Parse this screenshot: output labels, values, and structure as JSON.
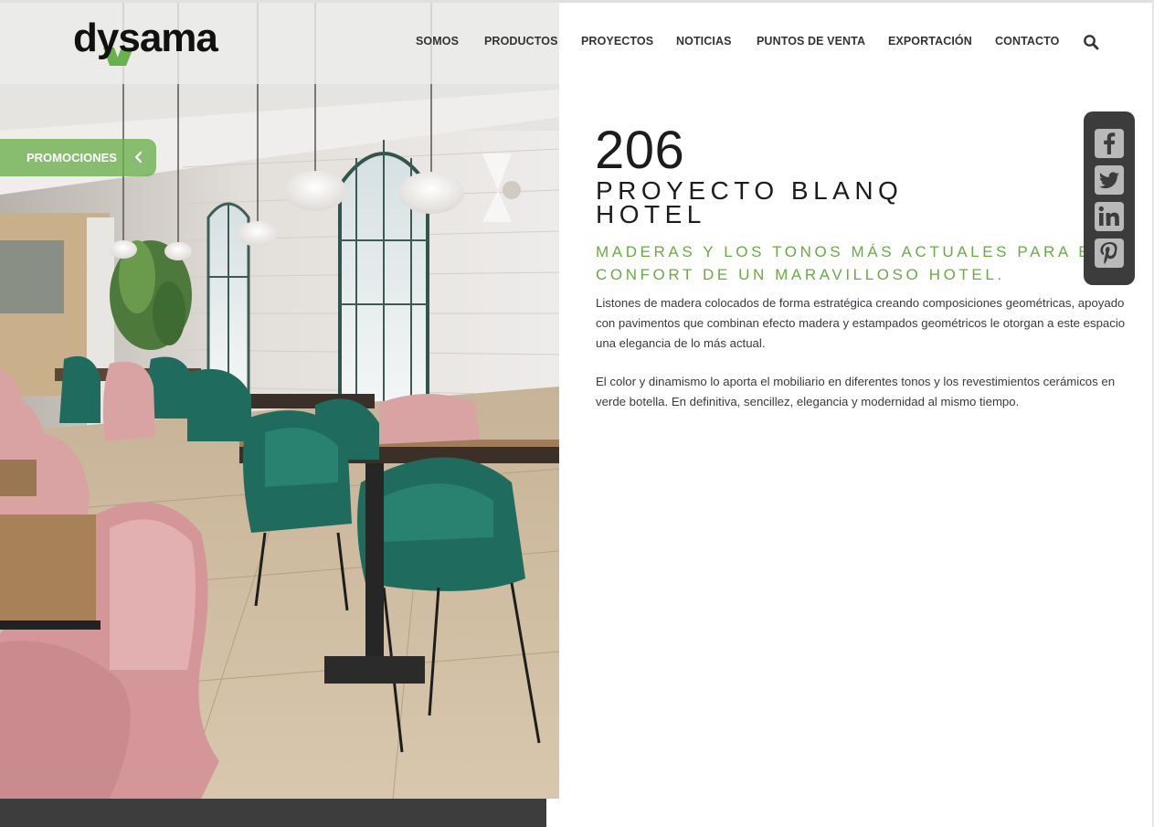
{
  "brand": {
    "name": "dysama",
    "accent_color": "#6aaa44"
  },
  "nav": {
    "items": [
      "SOMOS",
      "PRODUCTOS",
      "PROYECTOS",
      "NOTICIAS",
      "PUNTOS DE VENTA",
      "EXPORTACIÓN",
      "CONTACTO"
    ],
    "search_icon": "search-icon"
  },
  "promo": {
    "label": "PROMOCIONES",
    "icon": "chevron-left-icon"
  },
  "project": {
    "number": "206",
    "title_line1": "PROYECTO BLANQ",
    "title_line2": "HOTEL",
    "subtitle_line1": "MADERAS Y LOS TONOS MÁS ACTUALES PARA EL",
    "subtitle_line2": "CONFORT DE UN MARAVILLOSO HOTEL.",
    "paragraph1": "Listones de madera colocados de forma estratégica creando composiciones geométricas, apoyado con pavimentos que combinan efecto madera y estampados geométricos le otorgan a este espacio una elegancia de lo más actual.",
    "paragraph2": "El color y dinamismo lo aporta el mobiliario en diferentes tonos y los revestimientos cerámicos en verde botella. En definitiva, sencillez, elegancia y modernidad al mismo tiempo."
  },
  "social": {
    "icons": [
      "facebook-icon",
      "twitter-icon",
      "linkedin-icon",
      "pinterest-icon"
    ],
    "button_color": "#b9b9b9",
    "panel_color": "#3c3c3c"
  },
  "colors": {
    "footer_bar": "#3d3d3d",
    "header_band": "#ececec"
  }
}
